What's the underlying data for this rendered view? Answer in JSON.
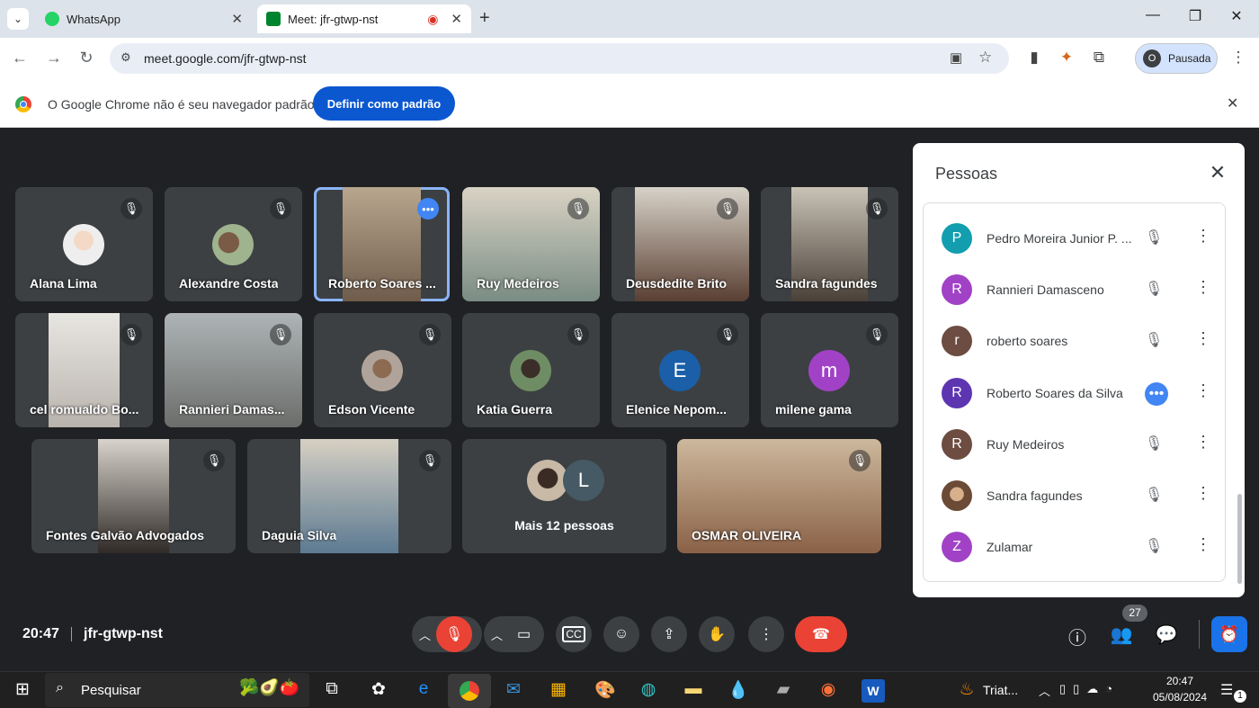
{
  "browser": {
    "tabs": [
      {
        "label": "WhatsApp",
        "fav_color": "#25d366"
      },
      {
        "label": "Meet: jfr-gtwp-nst",
        "fav_color": "#00832d"
      }
    ],
    "url": "meet.google.com/jfr-gtwp-nst",
    "profile_initial": "O",
    "profile_label": "Pausada",
    "infobar_text": "O Google Chrome não é seu navegador padrão",
    "infobar_button": "Definir como padrão"
  },
  "meeting": {
    "participants": [
      {
        "name": "Alana Lima"
      },
      {
        "name": "Alexandre Costa"
      },
      {
        "name": "Roberto Soares ..."
      },
      {
        "name": "Ruy Medeiros"
      },
      {
        "name": "Deusdedite Brito"
      },
      {
        "name": "Sandra fagundes"
      },
      {
        "name": "cel romualdo Bo..."
      },
      {
        "name": "Rannieri Damas..."
      },
      {
        "name": "Edson Vicente"
      },
      {
        "name": "Katia Guerra"
      },
      {
        "name": "Elenice Nepom...",
        "initial": "E",
        "color": "#1a5fa8"
      },
      {
        "name": "milene gama",
        "initial": "m",
        "color": "#a142c6"
      },
      {
        "name": "Fontes Galvão Advogados"
      },
      {
        "name": "Daguia Silva"
      },
      {
        "name": "OSMAR OLIVEIRA"
      }
    ],
    "more_label": "Mais 12 pessoas",
    "more_initial": "L",
    "time": "20:47",
    "code": "jfr-gtwp-nst",
    "people_count": "27"
  },
  "people_panel": {
    "title": "Pessoas",
    "people": [
      {
        "name": "Pedro Moreira Junior P. ...",
        "initial": "P",
        "color": "#129eaf"
      },
      {
        "name": "Rannieri Damasceno",
        "initial": "R",
        "color": "#a142c6"
      },
      {
        "name": "roberto soares",
        "initial": "r",
        "color": "#6d4c41"
      },
      {
        "name": "Roberto Soares da Silva",
        "initial": "R",
        "color": "#5e35b1",
        "speaking": true
      },
      {
        "name": "Ruy Medeiros",
        "initial": "R",
        "color": "#6d4c41"
      },
      {
        "name": "Sandra fagundes",
        "initial": "",
        "color": "#8d6e63"
      },
      {
        "name": "Zulamar",
        "initial": "Z",
        "color": "#a142c6"
      }
    ]
  },
  "taskbar": {
    "search_placeholder": "Pesquisar",
    "running_app": "Triat...",
    "clock_time": "20:47",
    "clock_date": "05/08/2024",
    "notif_count": "1"
  }
}
